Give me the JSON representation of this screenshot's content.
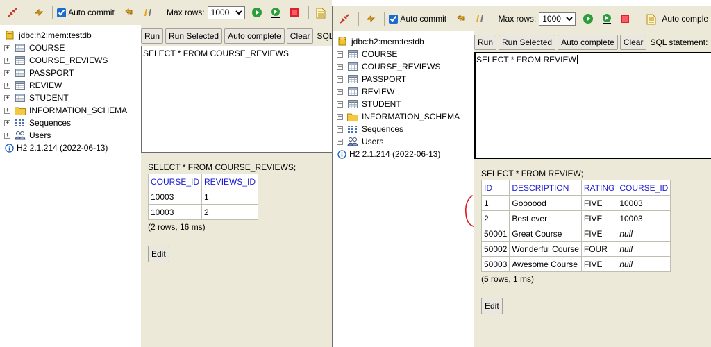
{
  "colors": {
    "toolbar_bg": "#ece9d8",
    "header_link": "#1b1bd1",
    "annotation": "#e01818"
  },
  "left": {
    "toolbar": {
      "auto_commit": "Auto commit",
      "max_rows_label": "Max rows:",
      "max_rows_value": "1000",
      "icons": [
        "disconnect-icon",
        "refresh-icon",
        "rollback-icon",
        "commit-icon",
        "run-icon",
        "run-selected-icon",
        "stop-icon",
        "history-icon"
      ]
    },
    "tree": {
      "connection": "jdbc:h2:mem:testdb",
      "items": [
        {
          "label": "COURSE",
          "icon": "table-icon"
        },
        {
          "label": "COURSE_REVIEWS",
          "icon": "table-icon"
        },
        {
          "label": "PASSPORT",
          "icon": "table-icon"
        },
        {
          "label": "REVIEW",
          "icon": "table-icon"
        },
        {
          "label": "STUDENT",
          "icon": "table-icon"
        },
        {
          "label": "INFORMATION_SCHEMA",
          "icon": "folder-icon"
        },
        {
          "label": "Sequences",
          "icon": "sequences-icon"
        },
        {
          "label": "Users",
          "icon": "users-icon"
        }
      ],
      "version": "H2 2.1.214 (2022-06-13)"
    },
    "buttons": {
      "run": "Run",
      "run_selected": "Run Selected",
      "auto_complete": "Auto complete",
      "clear": "Clear",
      "sql_label": "SQL s"
    },
    "sql": "SELECT * FROM COURSE_REVIEWS",
    "result": {
      "title": "SELECT * FROM COURSE_REVIEWS;",
      "columns": [
        "COURSE_ID",
        "REVIEWS_ID"
      ],
      "rows": [
        [
          "10003",
          "1"
        ],
        [
          "10003",
          "2"
        ]
      ],
      "summary": "(2 rows, 16 ms)",
      "edit": "Edit"
    }
  },
  "right": {
    "toolbar": {
      "auto_commit": "Auto commit",
      "max_rows_label": "Max rows:",
      "max_rows_value": "1000",
      "auto_complete": "Auto comple"
    },
    "tree": {
      "connection": "jdbc:h2:mem:testdb",
      "items": [
        {
          "label": "COURSE",
          "icon": "table-icon"
        },
        {
          "label": "COURSE_REVIEWS",
          "icon": "table-icon"
        },
        {
          "label": "PASSPORT",
          "icon": "table-icon"
        },
        {
          "label": "REVIEW",
          "icon": "table-icon"
        },
        {
          "label": "STUDENT",
          "icon": "table-icon"
        },
        {
          "label": "INFORMATION_SCHEMA",
          "icon": "folder-icon"
        },
        {
          "label": "Sequences",
          "icon": "sequences-icon"
        },
        {
          "label": "Users",
          "icon": "users-icon"
        }
      ],
      "version": "H2 2.1.214 (2022-06-13)"
    },
    "buttons": {
      "run": "Run",
      "run_selected": "Run Selected",
      "auto_complete": "Auto complete",
      "clear": "Clear",
      "sql_label": "SQL statement:"
    },
    "sql": "SELECT * FROM REVIEW",
    "result": {
      "title": "SELECT * FROM REVIEW;",
      "columns": [
        "ID",
        "DESCRIPTION",
        "RATING",
        "COURSE_ID"
      ],
      "rows": [
        [
          "1",
          "Goooood",
          "FIVE",
          "10003"
        ],
        [
          "2",
          "Best ever",
          "FIVE",
          "10003"
        ],
        [
          "50001",
          "Great Course",
          "FIVE",
          "null"
        ],
        [
          "50002",
          "Wonderful Course",
          "FOUR",
          "null"
        ],
        [
          "50003",
          "Awesome Course",
          "FIVE",
          "null"
        ]
      ],
      "summary": "(5 rows, 1 ms)",
      "edit": "Edit"
    }
  }
}
